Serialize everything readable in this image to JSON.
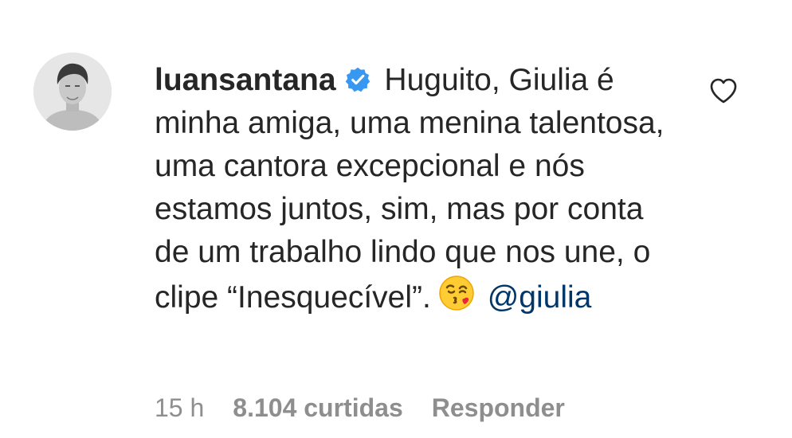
{
  "comment": {
    "username": "luansantana",
    "text_before_emoji": "Huguito, Giulia é minha amiga, uma menina talentosa, uma cantora excepcional e nós estamos juntos, sim, mas por conta de um trabalho lindo que nos une, o clipe “Inesquecível”.",
    "emoji": "face-blowing-a-kiss",
    "mention": "@giulia"
  },
  "meta": {
    "time": "15 h",
    "likes": "8.104 curtidas",
    "reply": "Responder"
  },
  "colors": {
    "text": "#262626",
    "muted": "#8e8e8e",
    "verified": "#3897f0",
    "mention": "#00376b"
  }
}
